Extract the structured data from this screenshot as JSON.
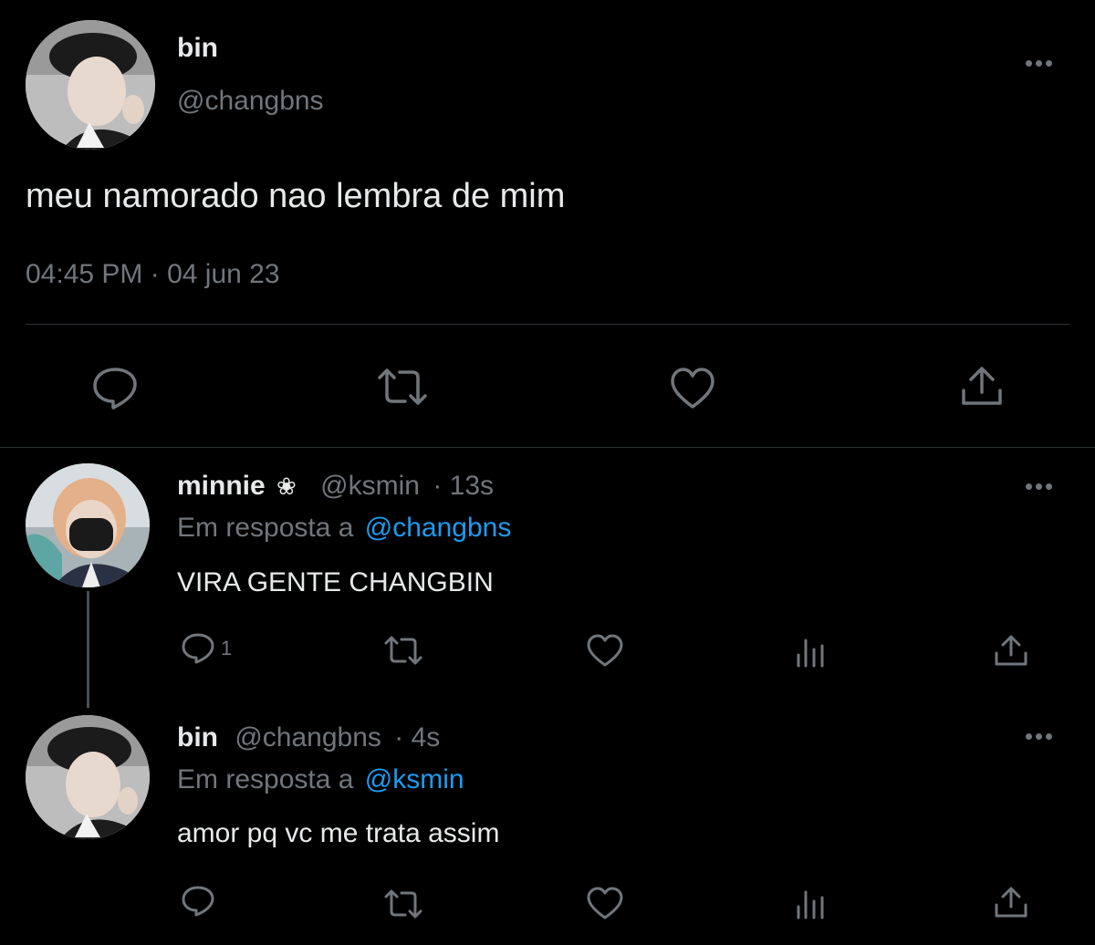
{
  "main_tweet": {
    "author_name": "bin",
    "handle": "@changbns",
    "text": "meu namorado nao lembra de mim",
    "timestamp": "04:45 PM · 04 jun 23",
    "actions": [
      "reply-icon",
      "retweet-icon",
      "like-icon",
      "share-icon"
    ]
  },
  "replies": [
    {
      "author_name": "minnie",
      "name_emoji": "❀",
      "handle": "@ksmin",
      "time": "· 13s",
      "reply_prefix": "Em resposta a",
      "reply_to": "@changbns",
      "text": "VIRA GENTE CHANGBIN",
      "reply_count": "1"
    },
    {
      "author_name": "bin",
      "handle": "@changbns",
      "time": "· 4s",
      "reply_prefix": "Em resposta a",
      "reply_to": "@ksmin",
      "text": "amor pq vc me trata assim",
      "reply_count": ""
    }
  ],
  "colors": {
    "background": "#000000",
    "text": "#e7e9ea",
    "muted": "#71767b",
    "link": "#1d9bf0",
    "divider": "#2f3336"
  }
}
